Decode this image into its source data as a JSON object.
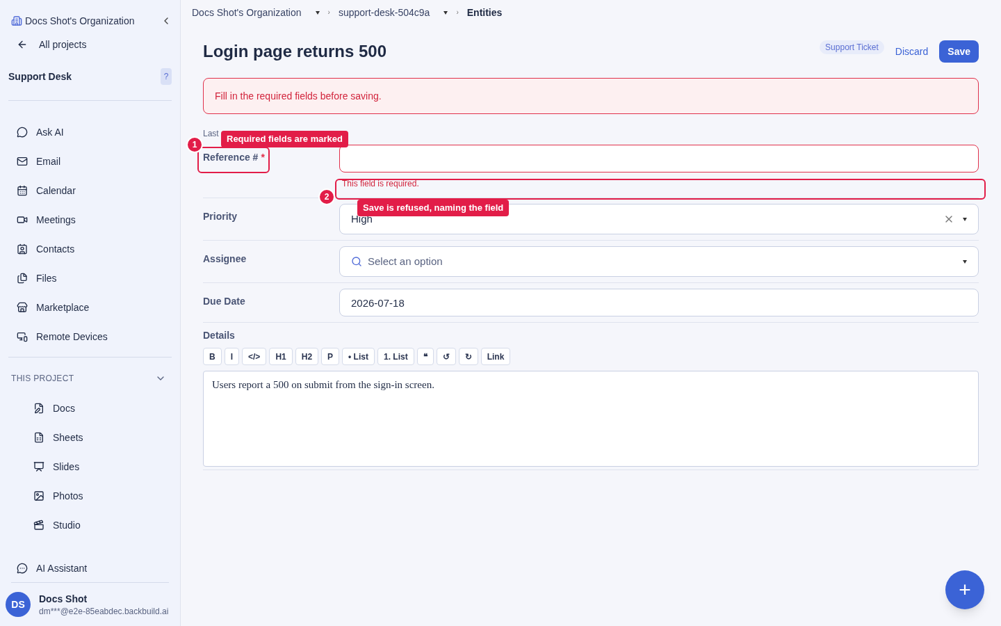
{
  "sidebar": {
    "org": "Docs Shot's Organization",
    "back": "All projects",
    "project": "Support Desk",
    "help": "?",
    "nav": [
      {
        "label": "Ask AI"
      },
      {
        "label": "Email"
      },
      {
        "label": "Calendar"
      },
      {
        "label": "Meetings"
      },
      {
        "label": "Contacts"
      },
      {
        "label": "Files"
      },
      {
        "label": "Marketplace"
      },
      {
        "label": "Remote Devices"
      }
    ],
    "section": {
      "title": "THIS PROJECT",
      "expanded": true,
      "items": [
        {
          "label": "Docs"
        },
        {
          "label": "Sheets"
        },
        {
          "label": "Slides"
        },
        {
          "label": "Photos"
        },
        {
          "label": "Studio"
        }
      ]
    },
    "assistant": "AI Assistant",
    "user": {
      "initials": "DS",
      "name": "Docs Shot",
      "email": "dm***@e2e-85eabdec.backbuild.ai"
    }
  },
  "breadcrumbs": [
    {
      "label": "Docs Shot's Organization",
      "dropdown": true
    },
    {
      "separator": "›",
      "label": "support-desk-504c9a",
      "dropdown": true
    },
    {
      "separator": "›",
      "label": "Entities",
      "dropdown": false
    }
  ],
  "title": "Login page returns 500",
  "tag": "Support Ticket",
  "discard": "Discard",
  "save": "Save",
  "alert": "Fill in the required fields before saving.",
  "last_label": "Last",
  "fields": [
    {
      "kind": "text",
      "label": "Reference #",
      "required_mark": "*",
      "error": "This field is required."
    },
    {
      "kind": "select",
      "label": "Priority",
      "value": "High",
      "clearable": true
    },
    {
      "kind": "select",
      "label": "Assignee",
      "placeholder": "Select an option",
      "clearable": false
    },
    {
      "kind": "text",
      "label": "Due Date",
      "value": "2026-07-18"
    }
  ],
  "details": {
    "label": "Details",
    "toolbar": [
      "B",
      "I",
      "</>",
      "H1",
      "H2",
      "P",
      "• List",
      "1. List",
      "❝",
      "↺",
      "↻",
      "Link"
    ],
    "text": "Users report a 500 on submit from the sign-in screen."
  },
  "annotations": [
    {
      "number": "1",
      "text": "Required fields are marked"
    },
    {
      "number": "2",
      "text": "Save is refused, naming the field"
    }
  ],
  "fab": "+"
}
